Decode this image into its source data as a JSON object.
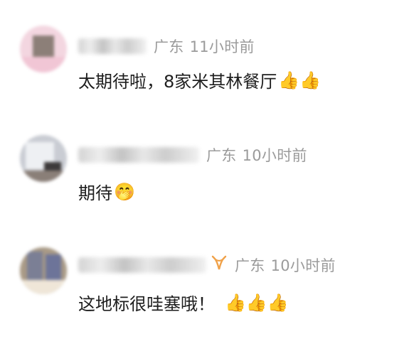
{
  "comments": [
    {
      "location": "广东",
      "time": "11小时前",
      "text": "太期待啦，8家米其林餐厅",
      "emojis": "👍👍"
    },
    {
      "location": "广东",
      "time": "10小时前",
      "text": "期待",
      "emojis": "🤭"
    },
    {
      "location": "广东",
      "time": "10小时前",
      "text": "这地标很哇塞哦！",
      "emojis": "👍👍👍"
    }
  ],
  "icons": {
    "badge_icon": "vip-ribbon-icon",
    "badge_color": "#f0a24a"
  }
}
